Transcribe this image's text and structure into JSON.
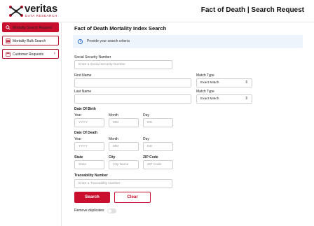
{
  "brand": {
    "name": "veritas",
    "tagline": "DATA RESEARCH",
    "accent": "#c8102e"
  },
  "header": {
    "title": "Fact of Death | Search Request"
  },
  "sidebar": {
    "items": [
      {
        "label": "Mortality Search Request",
        "icon": "search-icon",
        "active": true
      },
      {
        "label": "Mortality Bulk Search",
        "icon": "stack-icon",
        "active": false
      },
      {
        "label": "Customer Requests",
        "icon": "calendar-icon",
        "active": false,
        "chevron": "›"
      }
    ]
  },
  "main": {
    "title": "Fact of Death Mortality Index Search",
    "info_icon": "i",
    "info_text": "Provide your search criteria",
    "ssn": {
      "label": "Social Security Number",
      "placeholder": "Enter a Social Security Number"
    },
    "first_name": {
      "label": "First Name",
      "value": ""
    },
    "first_match": {
      "label": "Match Type",
      "value": "Exact Match"
    },
    "last_name": {
      "label": "Last Name",
      "value": ""
    },
    "last_match": {
      "label": "Match Type",
      "value": "Exact Match"
    },
    "dob": {
      "label": "Date Of Birth",
      "year_label": "Year",
      "month_label": "Month",
      "day_label": "Day",
      "year_ph": "YYYY",
      "month_ph": "MM",
      "day_ph": "DD"
    },
    "dod": {
      "label": "Date Of Death",
      "year_label": "Year",
      "month_label": "Month",
      "day_label": "Day",
      "year_ph": "YYYY",
      "month_ph": "MM",
      "day_ph": "DD"
    },
    "location": {
      "state_label": "State",
      "state_ph": "State",
      "city_label": "City",
      "city_ph": "City Name",
      "zip_label": "ZIP Code",
      "zip_ph": "ZIP Code"
    },
    "trace": {
      "label": "Traceability Number",
      "placeholder": "Enter a Traceability Number"
    },
    "search_label": "Search",
    "clear_label": "Clear",
    "remove_duplicates": {
      "label": "Remove duplicates",
      "on": false
    }
  }
}
